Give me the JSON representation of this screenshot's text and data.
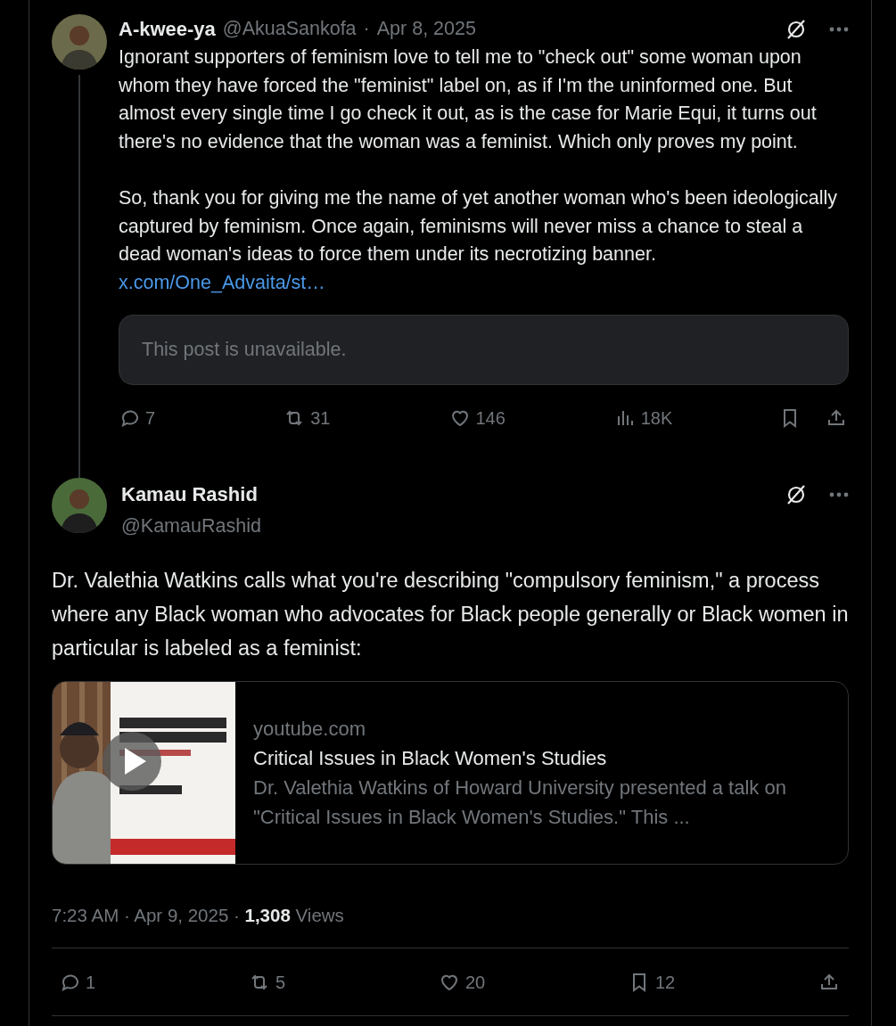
{
  "parent_post": {
    "author": {
      "name": "A-kwee-ya",
      "handle": "@AkuaSankofa"
    },
    "separator": "·",
    "date": "Apr 8, 2025",
    "paragraphs": [
      "Ignorant supporters of feminism love to tell me to \"check out\" some woman upon whom they have forced the \"feminist\" label on, as if I'm the uninformed one. But almost every single time I go check it out, as is the case for Marie Equi, it turns out there's no evidence that the woman was a feminist. Which only proves my point.",
      "So, thank you for giving me the name of yet another woman who's been ideologically captured by feminism. Once again, feminisms will never miss a chance to steal a dead woman's ideas to force them under its necrotizing banner."
    ],
    "link": "x.com/One_Advaita/st…",
    "quote": {
      "text": "This post is unavailable."
    },
    "actions": [
      {
        "kind": "reply",
        "count": "7"
      },
      {
        "kind": "repost",
        "count": "31"
      },
      {
        "kind": "like",
        "count": "146"
      },
      {
        "kind": "views",
        "count": "18K"
      },
      {
        "kind": "bookmark"
      },
      {
        "kind": "share"
      }
    ]
  },
  "main_post": {
    "author": {
      "name": "Kamau Rashid",
      "handle": "@KamauRashid"
    },
    "text": "Dr. Valethia Watkins calls what you're describing \"compulsory feminism,\" a process where any Black woman who advocates for Black people generally or Black women in particular is labeled as a feminist:",
    "card": {
      "domain": "youtube.com",
      "title": "Critical Issues in Black Women's Studies",
      "description": "Dr. Valethia Watkins of Howard University presented a talk on \"Critical Issues in Black Women's Studies.\" This ..."
    },
    "meta": "7:23 AM · Apr 9, 2025 · **1,308** Views",
    "actions": [
      {
        "kind": "reply",
        "count": "1"
      },
      {
        "kind": "repost",
        "count": "5"
      },
      {
        "kind": "like",
        "count": "20"
      },
      {
        "kind": "bookmark",
        "count": "12"
      },
      {
        "kind": "share"
      }
    ]
  }
}
